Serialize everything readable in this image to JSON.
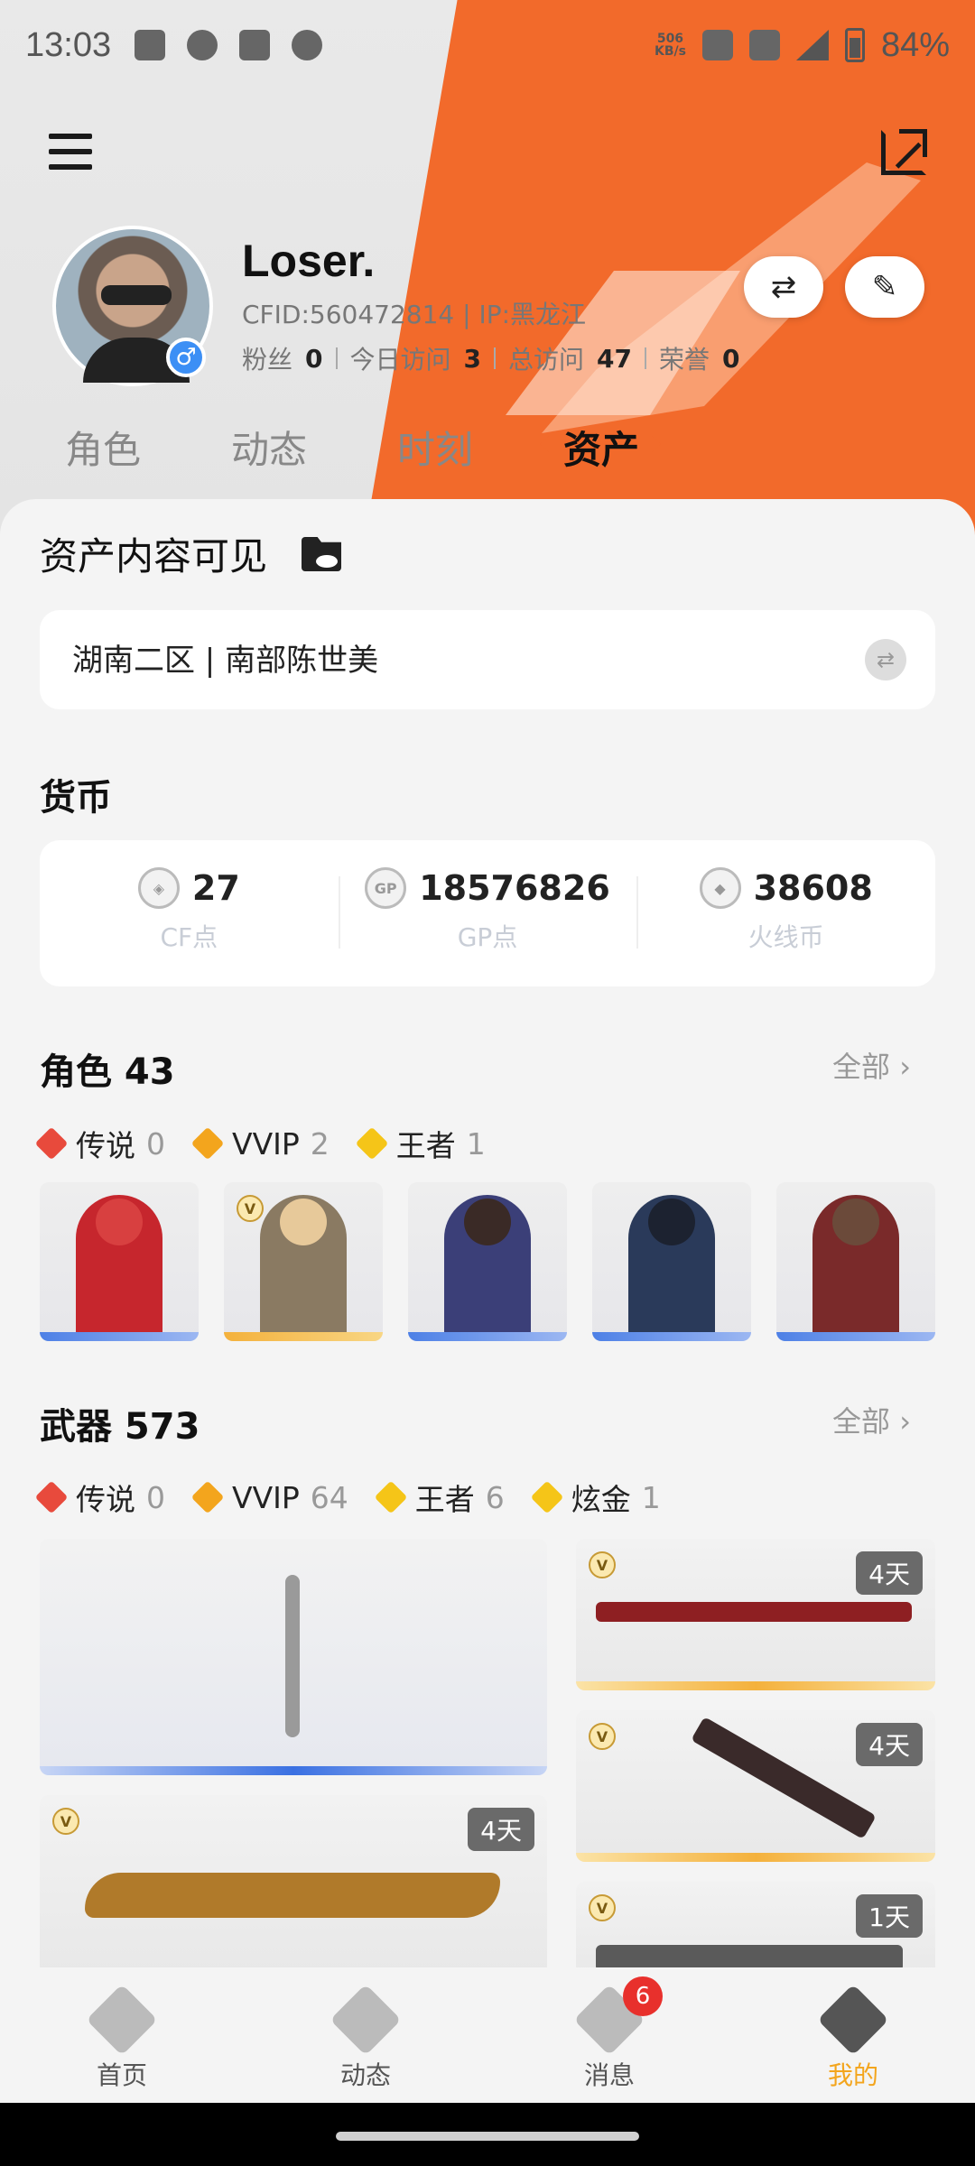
{
  "status_bar": {
    "time": "13:03",
    "net_speed_value": "506",
    "net_speed_unit": "KB/s",
    "battery": "84%"
  },
  "profile": {
    "name": "Loser.",
    "meta": "CFID:560472814 | IP:黑龙江",
    "stats": [
      {
        "label": "粉丝",
        "value": "0"
      },
      {
        "label": "今日访问",
        "value": "3"
      },
      {
        "label": "总访问",
        "value": "47"
      },
      {
        "label": "荣誉",
        "value": "0"
      }
    ],
    "gender_symbol": "♂"
  },
  "tabs": [
    "角色",
    "动态",
    "时刻",
    "资产"
  ],
  "active_tab": "资产",
  "assets": {
    "visibility_title": "资产内容可见",
    "server": "湖南二区 | 南部陈世美",
    "currency_title": "货币",
    "currency": [
      {
        "icon": "cf-icon",
        "value": "27",
        "label": "CF点"
      },
      {
        "icon": "gp-icon",
        "icon_text": "GP",
        "value": "18576826",
        "label": "GP点"
      },
      {
        "icon": "firecoin-icon",
        "value": "38608",
        "label": "火线币"
      }
    ],
    "roles": {
      "title": "角色 43",
      "more": "全部",
      "rarities": [
        {
          "label": "传说",
          "count": "0",
          "color": "#e84a3c"
        },
        {
          "label": "VVIP",
          "count": "2",
          "color": "#f3a51d"
        },
        {
          "label": "王者",
          "count": "1",
          "color": "#f5c518"
        }
      ]
    },
    "weapons": {
      "title": "武器 573",
      "more": "全部",
      "rarities": [
        {
          "label": "传说",
          "count": "0",
          "color": "#e84a3c"
        },
        {
          "label": "VVIP",
          "count": "64",
          "color": "#f3a51d"
        },
        {
          "label": "王者",
          "count": "6",
          "color": "#f5c518"
        },
        {
          "label": "炫金",
          "count": "1",
          "color": "#f5c518"
        }
      ],
      "day_tags": [
        "4天",
        "4天",
        "4天",
        "1天"
      ]
    }
  },
  "v_badge": "V",
  "bottom_nav": [
    {
      "label": "首页",
      "icon": "home-icon"
    },
    {
      "label": "动态",
      "icon": "feed-icon"
    },
    {
      "label": "消息",
      "icon": "message-icon",
      "badge": "6"
    },
    {
      "label": "我的",
      "icon": "profile-icon"
    }
  ],
  "colors": {
    "accent_orange": "#f26a2b",
    "active_nav": "#f3a51d",
    "badge_red": "#e8302c"
  }
}
